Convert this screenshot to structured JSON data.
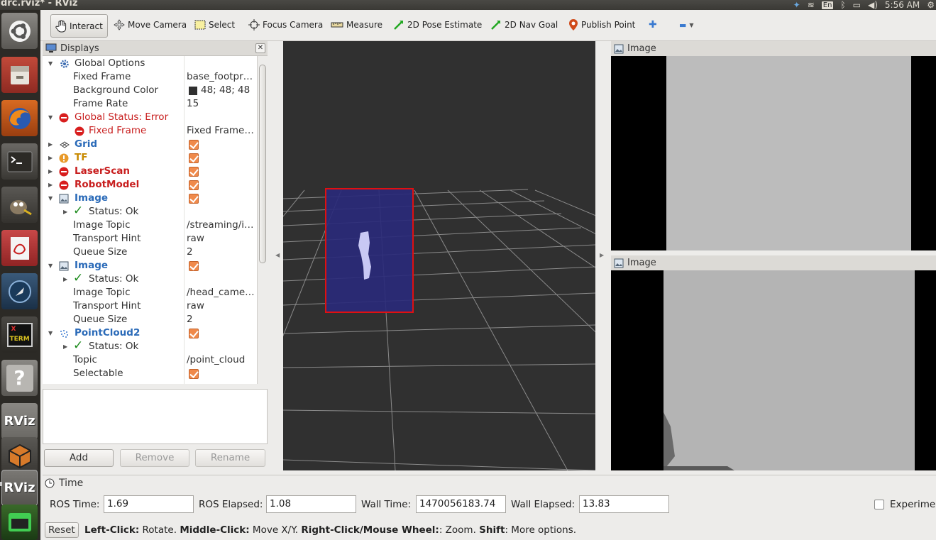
{
  "window": {
    "title": "drc.rviz* - RViz"
  },
  "tray": {
    "lang": "En",
    "clock": "5:56 AM"
  },
  "launcher": {
    "rviz_label": "RViz",
    "xterm_label_1": "X",
    "xterm_label_2": "TERM",
    "help_label": "?"
  },
  "toolbar": {
    "interact": "Interact",
    "move_camera": "Move Camera",
    "select": "Select",
    "focus_camera": "Focus Camera",
    "measure": "Measure",
    "pose_estimate": "2D Pose Estimate",
    "nav_goal": "2D Nav Goal",
    "publish_point": "Publish Point",
    "plus": "✚",
    "minus": "▬"
  },
  "displays": {
    "title": "Displays",
    "rows": [
      {
        "label": "Global Options"
      },
      {
        "label": "Fixed Frame",
        "value": "base_footprint"
      },
      {
        "label": "Background Color",
        "value": "48; 48; 48"
      },
      {
        "label": "Frame Rate",
        "value": "15"
      },
      {
        "label": "Global Status: Error"
      },
      {
        "label": "Fixed Frame",
        "value": "Fixed Frame [base_footprint] does not exist"
      },
      {
        "label": "Grid"
      },
      {
        "label": "TF"
      },
      {
        "label": "LaserScan"
      },
      {
        "label": "RobotModel"
      },
      {
        "label": "Image"
      },
      {
        "label": "Status: Ok"
      },
      {
        "label": "Image Topic",
        "value": "/streaming/image"
      },
      {
        "label": "Transport Hint",
        "value": "raw"
      },
      {
        "label": "Queue Size",
        "value": "2"
      },
      {
        "label": "Image"
      },
      {
        "label": "Status: Ok"
      },
      {
        "label": "Image Topic",
        "value": "/head_camera/image"
      },
      {
        "label": "Transport Hint",
        "value": "raw"
      },
      {
        "label": "Queue Size",
        "value": "2"
      },
      {
        "label": "PointCloud2"
      },
      {
        "label": "Status: Ok"
      },
      {
        "label": "Topic",
        "value": "/point_cloud"
      },
      {
        "label": "Selectable"
      }
    ],
    "buttons": {
      "add": "Add",
      "remove": "Remove",
      "rename": "Rename"
    }
  },
  "image_panels": {
    "top_title": "Image",
    "bottom_title": "Image"
  },
  "time": {
    "title": "Time",
    "ros_time_label": "ROS Time:",
    "ros_time": "1.69",
    "ros_elapsed_label": "ROS Elapsed:",
    "ros_elapsed": "1.08",
    "wall_time_label": "Wall Time:",
    "wall_time": "1470056183.74",
    "wall_elapsed_label": "Wall Elapsed:",
    "wall_elapsed": "13.83",
    "experimental_label": "Experimental"
  },
  "status": {
    "reset": "Reset",
    "left_click": "Left-Click:",
    "left_click_desc": " Rotate. ",
    "middle_click": "Middle-Click:",
    "middle_click_desc": " Move X/Y. ",
    "right_click": "Right-Click/Mouse Wheel:",
    "right_click_desc": ": Zoom. ",
    "shift": "Shift",
    "shift_desc": ": More options."
  },
  "colors": {
    "background": "#303030",
    "selection_box": "#e01010",
    "selection_fill": "#2a2a7a",
    "error": "#c81e1e",
    "ok": "#1a8a1a",
    "checkbox": "#f08a4b"
  }
}
